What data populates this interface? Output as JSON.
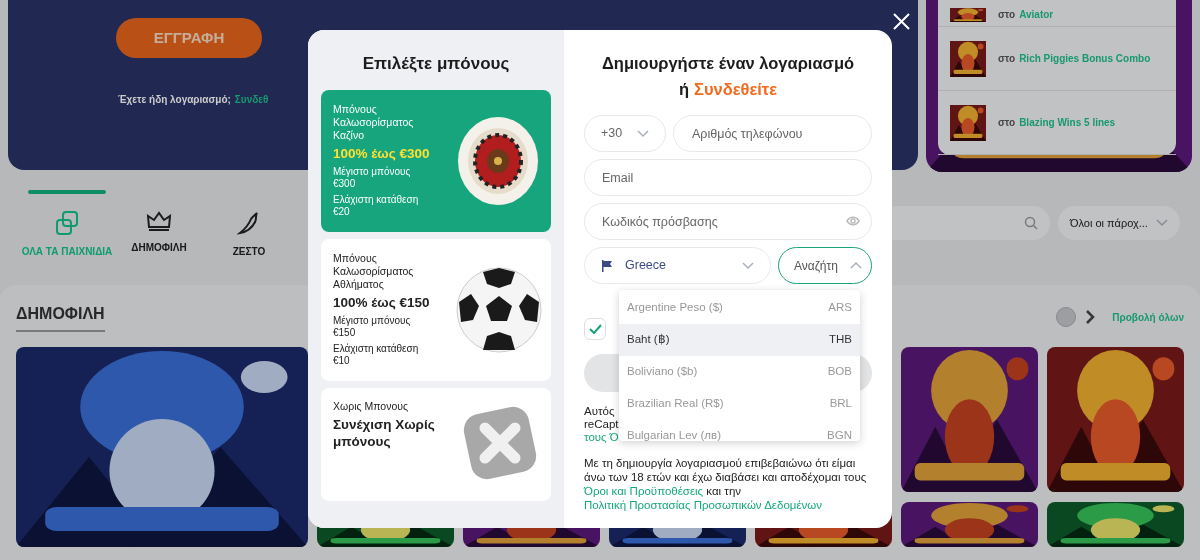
{
  "background": {
    "hero": {
      "button": "ΕΓΓΡΑΦΗ",
      "note": "Έχετε ήδη λογαριασμό;",
      "note_link": "Συνδεθ"
    },
    "winners": [
      {
        "prefix": "στο",
        "game": "Aviator"
      },
      {
        "prefix": "στο",
        "game": "Rich Piggies Bonus Combo"
      },
      {
        "prefix": "στο",
        "game": "Blazing Wins 5 lines"
      }
    ],
    "tabs": [
      {
        "label": "ΟΛΑ ΤΑ ΠΑΙΧΝΙΔΙΑ",
        "selected": true,
        "kind": "dice"
      },
      {
        "label": "ΔΗΜΟΦΙΛΗ",
        "selected": false,
        "kind": "crown"
      },
      {
        "label": "ΖΕΣΤΟ",
        "selected": false,
        "kind": "pepper"
      }
    ],
    "provider_select": "Όλοι οι πάροχ...",
    "section_title": "ΔΗΜΟΦΙΛΗ",
    "view_all": "Προβολή όλων"
  },
  "modal": {
    "bonus_title": "Επιλέξτε μπόνους",
    "bonuses": [
      {
        "kind": "casino",
        "selected": true,
        "label": "Μπόνους Καλωσορίσματος Καζίνο",
        "headline": "100% έως €300",
        "details": [
          "Μέγιστο μπόνους €300",
          "Ελάχιστη κατάθεση €20"
        ]
      },
      {
        "kind": "sport",
        "selected": false,
        "label": "Μπόνους Καλωσορίσματος Αθλήματος",
        "headline": "100% έως €150",
        "details": [
          "Μέγιστο μπόνους €150",
          "Ελάχιστη κατάθεση €10"
        ]
      },
      {
        "kind": "none",
        "selected": false,
        "label": "Χωρις Μπονους",
        "headline": "Συνέχιση Χωρίς μπόνους"
      }
    ],
    "title": "Δημιουργήστε έναν λογαριασμό",
    "title_or": "ή",
    "login_link": "Συνδεθείτε",
    "phone_code": "+30",
    "phone_placeholder": "Αριθμός τηλεφώνου",
    "email_placeholder": "Email",
    "password_placeholder": "Κωδικός πρόσβασης",
    "country": "Greece",
    "currency_placeholder": "Αναζήτη",
    "currency_options": [
      {
        "name": "Argentine Peso ($)",
        "code": "ARS",
        "selected": false
      },
      {
        "name": "Baht (฿)",
        "code": "THB",
        "selected": true
      },
      {
        "name": "Boliviano ($b)",
        "code": "BOB",
        "selected": false
      },
      {
        "name": "Brazilian Real (R$)",
        "code": "BRL",
        "selected": false
      },
      {
        "name": "Bulgarian Lev (лв)",
        "code": "BGN",
        "selected": false
      }
    ],
    "agree_checked": true,
    "recaptcha_fragments": [
      "Αυτός",
      "reCapt",
      "τους Ό"
    ],
    "terms_text": "Με τη δημιουργία λογαριασμού επιβεβαιώνω ότι είμαι άνω των 18 ετών και έχω διαβάσει και αποδέχομαι τους",
    "terms_link": "Όροι και Προϋποθέσεις",
    "terms_and": "και την",
    "privacy_link": "Πολιτική Προστασίας Προσωπικών Δεδομένων"
  }
}
